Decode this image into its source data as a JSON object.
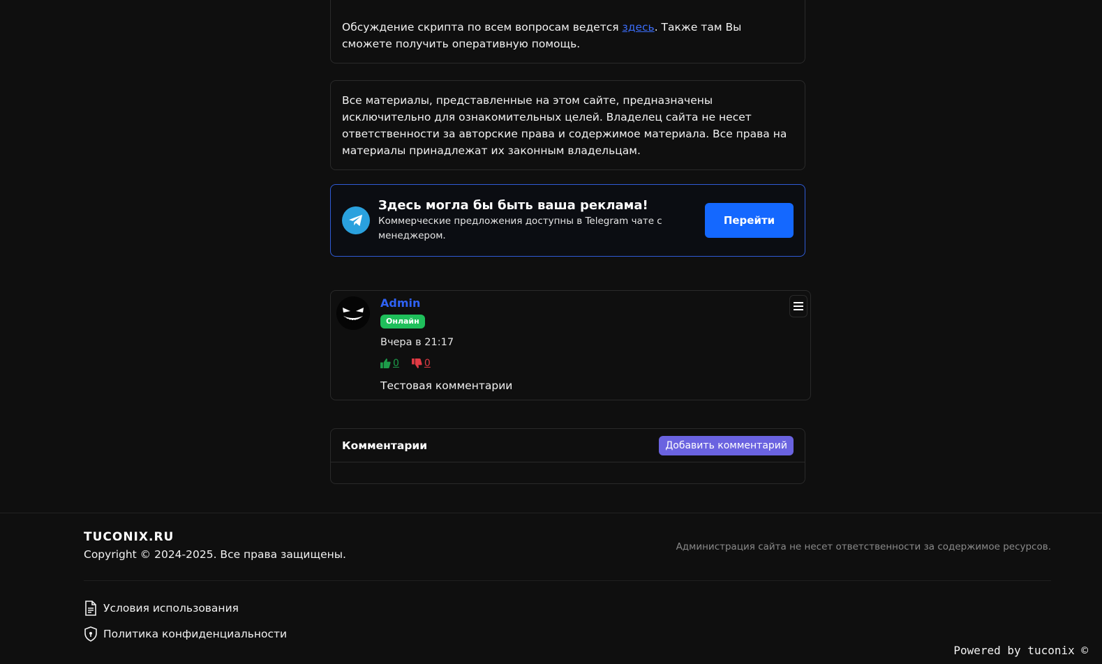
{
  "discussion": {
    "text_before": "Обсуждение скрипта по всем вопросам ведется ",
    "link": "здесь",
    "text_after": ". Также там Вы сможете получить оперативную помощь."
  },
  "disclaimer": {
    "text": "Все материалы, представленные на этом сайте, предназначены исключительно для ознакомительных целей. Владелец сайта не несет ответственности за авторские права и содержимое материала. Все права на материалы принадлежат их законным владельцам."
  },
  "ad": {
    "title": "Здесь могла бы быть ваша реклама!",
    "description": "Коммерческие предложения доступны в Telegram чате с менеджером.",
    "button": "Перейти",
    "icon": "telegram-icon"
  },
  "comment": {
    "author": "Admin",
    "status": "Онлайн",
    "time": "Вчера в 21:17",
    "likes": "0",
    "dislikes": "0",
    "text": "Тестовая комментарии"
  },
  "comments_section": {
    "title": "Комментарии",
    "add_button": "Добавить комментарий"
  },
  "footer": {
    "brand": "TUCONIX.RU",
    "copyright": "Copyright © 2024-2025. Все права защищены.",
    "note": "Администрация сайта не несет ответственности за содержимое ресурсов.",
    "links": {
      "terms": "Условия использования",
      "privacy": "Политика конфиденциальности"
    },
    "powered": "Powered by tuconix ©"
  },
  "colors": {
    "background": "#0f0f0f",
    "accent": "#1468ff",
    "online": "#1fbf5b",
    "add_button": "#6a63e0"
  }
}
